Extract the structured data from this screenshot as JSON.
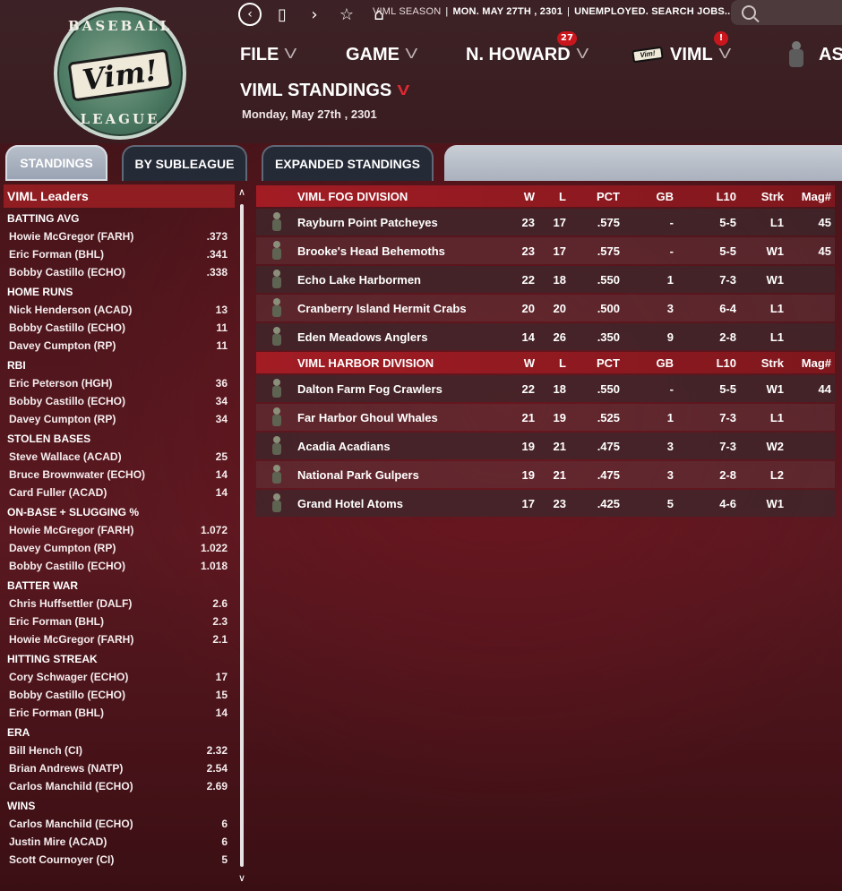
{
  "logo": {
    "top_text": "BASEBALL",
    "bottom_text": "LEAGUE",
    "brand": "Vim!"
  },
  "breadcrumb": {
    "part1": "VIML SEASON",
    "part2": "MON. MAY 27TH , 2301",
    "part3": "UNEMPLOYED. SEARCH JOBS..."
  },
  "menu": {
    "file": "FILE",
    "game": "GAME",
    "manager": "N. HOWARD",
    "manager_badge": "27",
    "league": "VIML",
    "league_badge": "!",
    "extra": "AS"
  },
  "page": {
    "title": "VIML STANDINGS",
    "date": "Monday, May 27th , 2301"
  },
  "tabs": [
    {
      "label": "STANDINGS",
      "active": true
    },
    {
      "label": "BY SUBLEAGUE",
      "active": false
    },
    {
      "label": "EXPANDED STANDINGS",
      "active": false
    }
  ],
  "leaders": {
    "title": "VIML Leaders",
    "categories": [
      {
        "name": "BATTING AVG",
        "rows": [
          [
            "Howie McGregor (FARH)",
            ".373"
          ],
          [
            "Eric Forman (BHL)",
            ".341"
          ],
          [
            "Bobby Castillo (ECHO)",
            ".338"
          ]
        ]
      },
      {
        "name": "HOME RUNS",
        "rows": [
          [
            "Nick Henderson (ACAD)",
            "13"
          ],
          [
            "Bobby Castillo (ECHO)",
            "11"
          ],
          [
            "Davey Cumpton (RP)",
            "11"
          ]
        ]
      },
      {
        "name": "RBI",
        "rows": [
          [
            "Eric Peterson (HGH)",
            "36"
          ],
          [
            "Bobby Castillo (ECHO)",
            "34"
          ],
          [
            "Davey Cumpton (RP)",
            "34"
          ]
        ]
      },
      {
        "name": "STOLEN BASES",
        "rows": [
          [
            "Steve Wallace (ACAD)",
            "25"
          ],
          [
            "Bruce Brownwater (ECHO)",
            "14"
          ],
          [
            "Card Fuller (ACAD)",
            "14"
          ]
        ]
      },
      {
        "name": "ON-BASE + SLUGGING %",
        "rows": [
          [
            "Howie McGregor (FARH)",
            "1.072"
          ],
          [
            "Davey Cumpton (RP)",
            "1.022"
          ],
          [
            "Bobby Castillo (ECHO)",
            "1.018"
          ]
        ]
      },
      {
        "name": "BATTER WAR",
        "rows": [
          [
            "Chris Huffsettler (DALF)",
            "2.6"
          ],
          [
            "Eric Forman (BHL)",
            "2.3"
          ],
          [
            "Howie McGregor (FARH)",
            "2.1"
          ]
        ]
      },
      {
        "name": "HITTING STREAK",
        "rows": [
          [
            "Cory Schwager (ECHO)",
            "17"
          ],
          [
            "Bobby Castillo (ECHO)",
            "15"
          ],
          [
            "Eric Forman (BHL)",
            "14"
          ]
        ]
      },
      {
        "name": "ERA",
        "rows": [
          [
            "Bill Hench (CI)",
            "2.32"
          ],
          [
            "Brian Andrews (NATP)",
            "2.54"
          ],
          [
            "Carlos Manchild (ECHO)",
            "2.69"
          ]
        ]
      },
      {
        "name": "WINS",
        "rows": [
          [
            "Carlos Manchild (ECHO)",
            "6"
          ],
          [
            "Justin Mire (ACAD)",
            "6"
          ],
          [
            "Scott Cournoyer (CI)",
            "5"
          ]
        ]
      }
    ]
  },
  "standings": {
    "columns": [
      "W",
      "L",
      "PCT",
      "GB",
      "L10",
      "Strk",
      "Mag#"
    ],
    "divisions": [
      {
        "name": "VIML FOG DIVISION",
        "teams": [
          {
            "name": "Rayburn Point Patcheyes",
            "icon": "mascot-icon",
            "w": "23",
            "l": "17",
            "pct": ".575",
            "gb": "-",
            "l10": "5-5",
            "strk": "L1",
            "mag": "45"
          },
          {
            "name": "Brooke's Head Behemoths",
            "icon": "mascot-icon",
            "w": "23",
            "l": "17",
            "pct": ".575",
            "gb": "-",
            "l10": "5-5",
            "strk": "W1",
            "mag": "45"
          },
          {
            "name": "Echo Lake Harbormen",
            "icon": "mascot-icon",
            "w": "22",
            "l": "18",
            "pct": ".550",
            "gb": "1",
            "l10": "7-3",
            "strk": "W1",
            "mag": ""
          },
          {
            "name": "Cranberry Island Hermit Crabs",
            "icon": "mascot-icon",
            "w": "20",
            "l": "20",
            "pct": ".500",
            "gb": "3",
            "l10": "6-4",
            "strk": "L1",
            "mag": ""
          },
          {
            "name": "Eden Meadows Anglers",
            "icon": "mascot-icon",
            "w": "14",
            "l": "26",
            "pct": ".350",
            "gb": "9",
            "l10": "2-8",
            "strk": "L1",
            "mag": ""
          }
        ]
      },
      {
        "name": "VIML HARBOR DIVISION",
        "teams": [
          {
            "name": "Dalton Farm Fog Crawlers",
            "icon": "mascot-icon",
            "w": "22",
            "l": "18",
            "pct": ".550",
            "gb": "-",
            "l10": "5-5",
            "strk": "W1",
            "mag": "44"
          },
          {
            "name": "Far Harbor Ghoul Whales",
            "icon": "mascot-icon",
            "w": "21",
            "l": "19",
            "pct": ".525",
            "gb": "1",
            "l10": "7-3",
            "strk": "L1",
            "mag": ""
          },
          {
            "name": "Acadia Acadians",
            "icon": "mascot-icon",
            "w": "19",
            "l": "21",
            "pct": ".475",
            "gb": "3",
            "l10": "7-3",
            "strk": "W2",
            "mag": ""
          },
          {
            "name": "National Park Gulpers",
            "icon": "mascot-icon",
            "w": "19",
            "l": "21",
            "pct": ".475",
            "gb": "3",
            "l10": "2-8",
            "strk": "L2",
            "mag": ""
          },
          {
            "name": "Grand Hotel Atoms",
            "icon": "mascot-icon",
            "w": "17",
            "l": "23",
            "pct": ".425",
            "gb": "5",
            "l10": "4-6",
            "strk": "W1",
            "mag": ""
          }
        ]
      }
    ]
  },
  "colors": {
    "accent": "#a31c24",
    "badge": "#c9161d",
    "background": "#4a151b"
  }
}
